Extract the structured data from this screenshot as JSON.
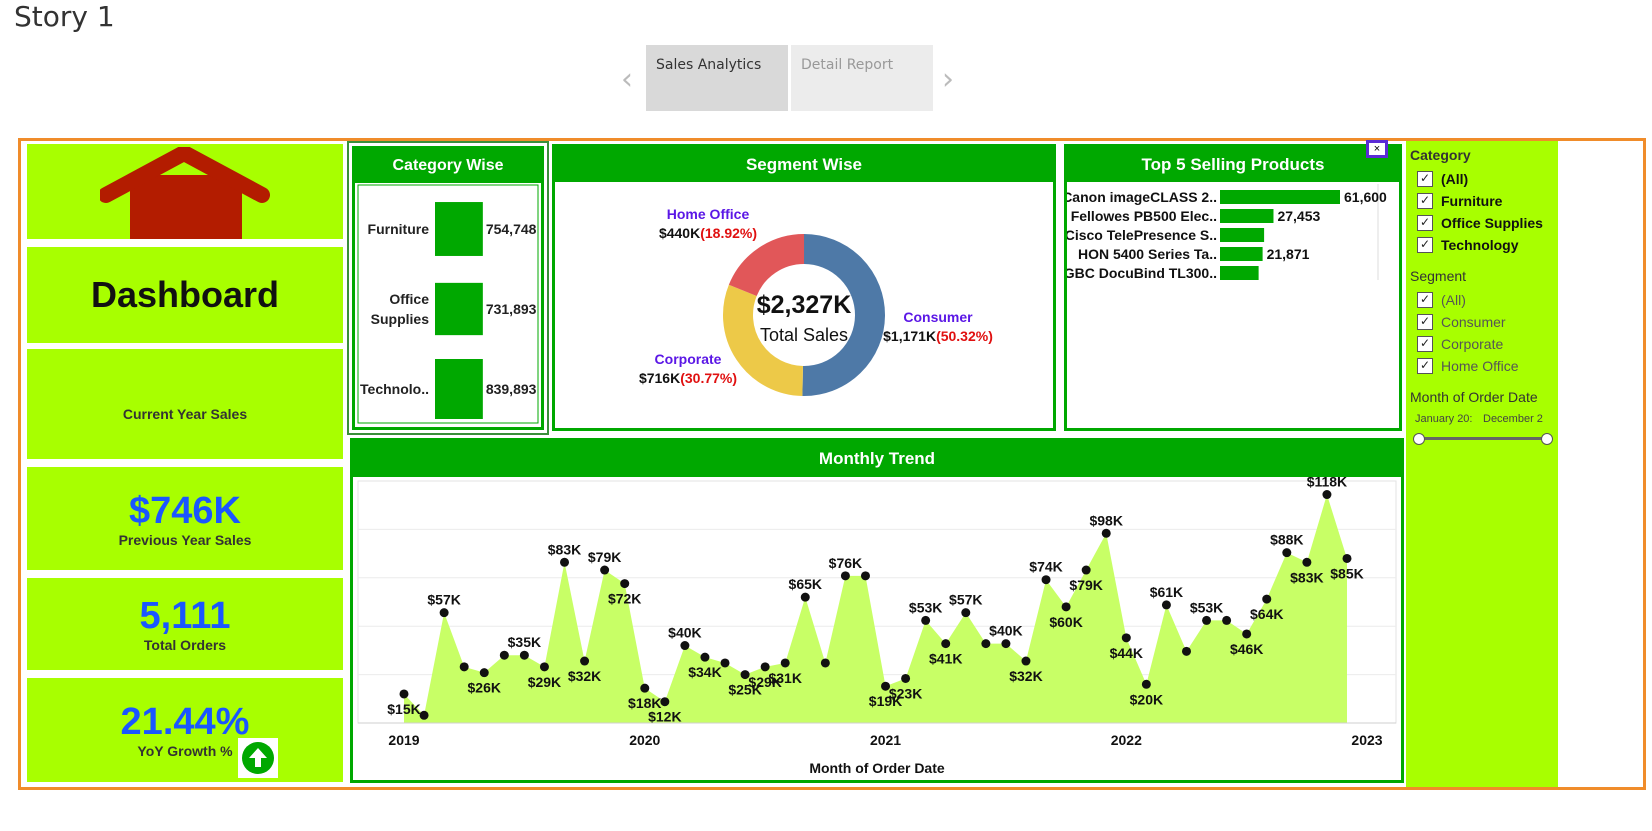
{
  "story_title": "Story 1",
  "story_tabs": [
    {
      "label": "Sales Analytics",
      "active": true
    },
    {
      "label": "Detail Report",
      "active": false
    }
  ],
  "left_panel": {
    "dashboard_title": "Dashboard",
    "current_year_label": "Current Year Sales",
    "previous_year_value": "$746K",
    "previous_year_label": "Previous Year Sales",
    "total_orders_value": "5,111",
    "total_orders_label": "Total Orders",
    "yoy_value": "21.44%",
    "yoy_label": "YoY Growth %"
  },
  "category_wise": {
    "title": "Category Wise",
    "categories": [
      "Furniture",
      "Office Supplies",
      "Technolo.."
    ],
    "values": [
      754748,
      731893,
      839893
    ],
    "labels": [
      "754,748",
      "731,893",
      "839,893"
    ]
  },
  "segment_wise": {
    "title": "Segment Wise",
    "center_value": "$2,327K",
    "center_label": "Total Sales",
    "segments": [
      {
        "name": "Consumer",
        "value_text": "$1,171K",
        "pct_text": "(50.32%)",
        "pct": 50.32,
        "color": "#4e79a7"
      },
      {
        "name": "Corporate",
        "value_text": "$716K",
        "pct_text": "(30.77%)",
        "pct": 30.77,
        "color": "#edc948"
      },
      {
        "name": "Home Office",
        "value_text": "$440K",
        "pct_text": "(18.92%)",
        "pct": 18.92,
        "color": "#e15759"
      }
    ]
  },
  "top5": {
    "title": "Top 5 Selling Products",
    "products": [
      "Canon imageCLASS 2..",
      "Fellowes PB500 Elec..",
      "Cisco TelePresence S..",
      "HON 5400 Series Ta..",
      "GBC DocuBind TL300.."
    ],
    "values": [
      61600,
      27453,
      22638,
      21871,
      19823
    ],
    "labels": [
      "61,600",
      "27,453",
      "",
      "21,871",
      ""
    ]
  },
  "chart_data": {
    "type": "area",
    "title": "Monthly Trend",
    "xlabel": "Month of Order Date",
    "ylabel": "",
    "x_ticks": [
      "2019",
      "2020",
      "2021",
      "2022",
      "2023"
    ],
    "values": [
      15,
      4,
      57,
      29,
      26,
      35,
      35,
      29,
      83,
      32,
      79,
      72,
      18,
      11,
      40,
      34,
      31,
      25,
      29,
      31,
      65,
      31,
      76,
      76,
      19,
      23,
      53,
      41,
      57,
      41,
      41,
      32,
      74,
      60,
      79,
      98,
      44,
      20,
      61,
      37,
      53,
      53,
      46,
      64,
      88,
      83,
      118,
      85
    ],
    "labels": [
      "$15K",
      "",
      "$57K",
      "",
      "$26K",
      "",
      "$35K",
      "$29K",
      "$83K",
      "$32K",
      "$79K",
      "$72K",
      "$18K",
      "$12K",
      "$40K",
      "$34K",
      "",
      "$25K",
      "$29K",
      "$31K",
      "$65K",
      "",
      "$76K",
      "",
      "$19K",
      "$23K",
      "$53K",
      "$41K",
      "$57K",
      "",
      "$40K",
      "$32K",
      "$74K",
      "$60K",
      "$79K",
      "$98K",
      "$44K",
      "$20K",
      "$61K",
      "",
      "$53K",
      "",
      "$46K",
      "$64K",
      "$88K",
      "$83K",
      "$118K",
      "$85K"
    ],
    "ylim": [
      0,
      125
    ],
    "fill_color": "#c8ff66",
    "grid": true
  },
  "filters": {
    "category_title": "Category",
    "category_items": [
      "(All)",
      "Furniture",
      "Office Supplies",
      "Technology"
    ],
    "segment_title": "Segment",
    "segment_items": [
      "(All)",
      "Consumer",
      "Corporate",
      "Home Office"
    ],
    "month_title": "Month of Order Date",
    "range_start": "January 20:",
    "range_end": "December 2"
  },
  "colors": {
    "lime": "#a8ff00",
    "green": "#00a800",
    "kpi_blue": "#1a56ff",
    "orange_border": "#f08c2a",
    "dark_red": "#b31c00"
  }
}
